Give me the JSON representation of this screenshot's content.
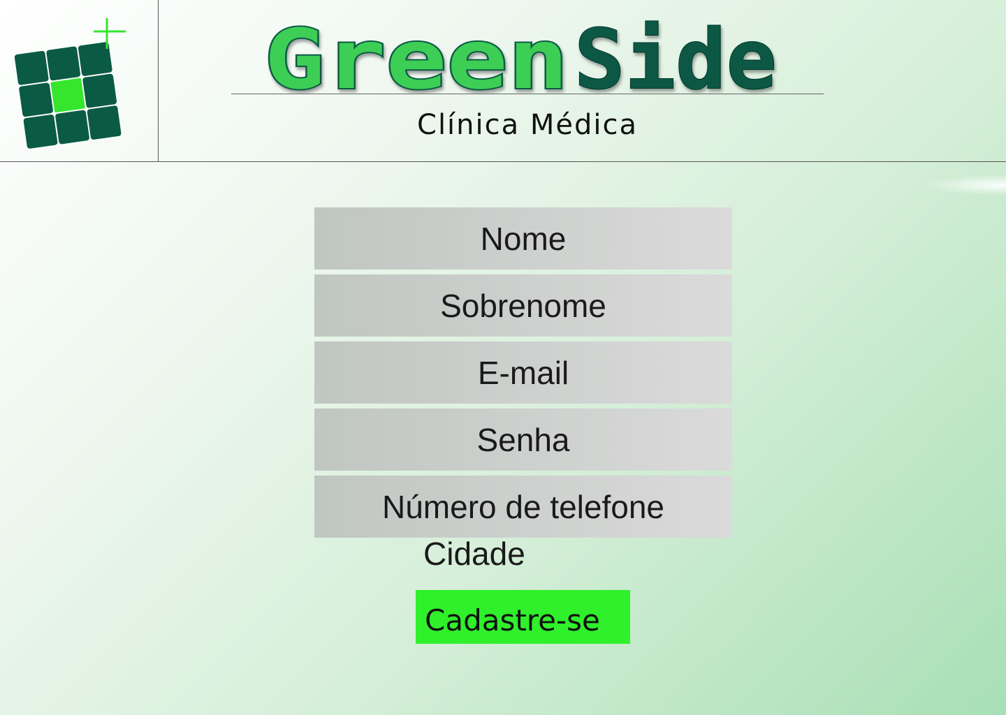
{
  "header": {
    "brand_part1": "Green",
    "brand_part2": "Side",
    "subtitle": "Clínica Médica"
  },
  "colors": {
    "brand_light_green": "#3ecf55",
    "brand_dark_green": "#075945",
    "logo_tile": "#0b5a44",
    "logo_center": "#35e62c",
    "button": "#2ff02b"
  },
  "form": {
    "fields": [
      {
        "placeholder": "Nome"
      },
      {
        "placeholder": "Sobrenome"
      },
      {
        "placeholder": "E-mail"
      },
      {
        "placeholder": "Senha"
      },
      {
        "placeholder": "Número de telefone"
      }
    ],
    "city_label": "Cidade",
    "submit_label": "Cadastre-se"
  }
}
